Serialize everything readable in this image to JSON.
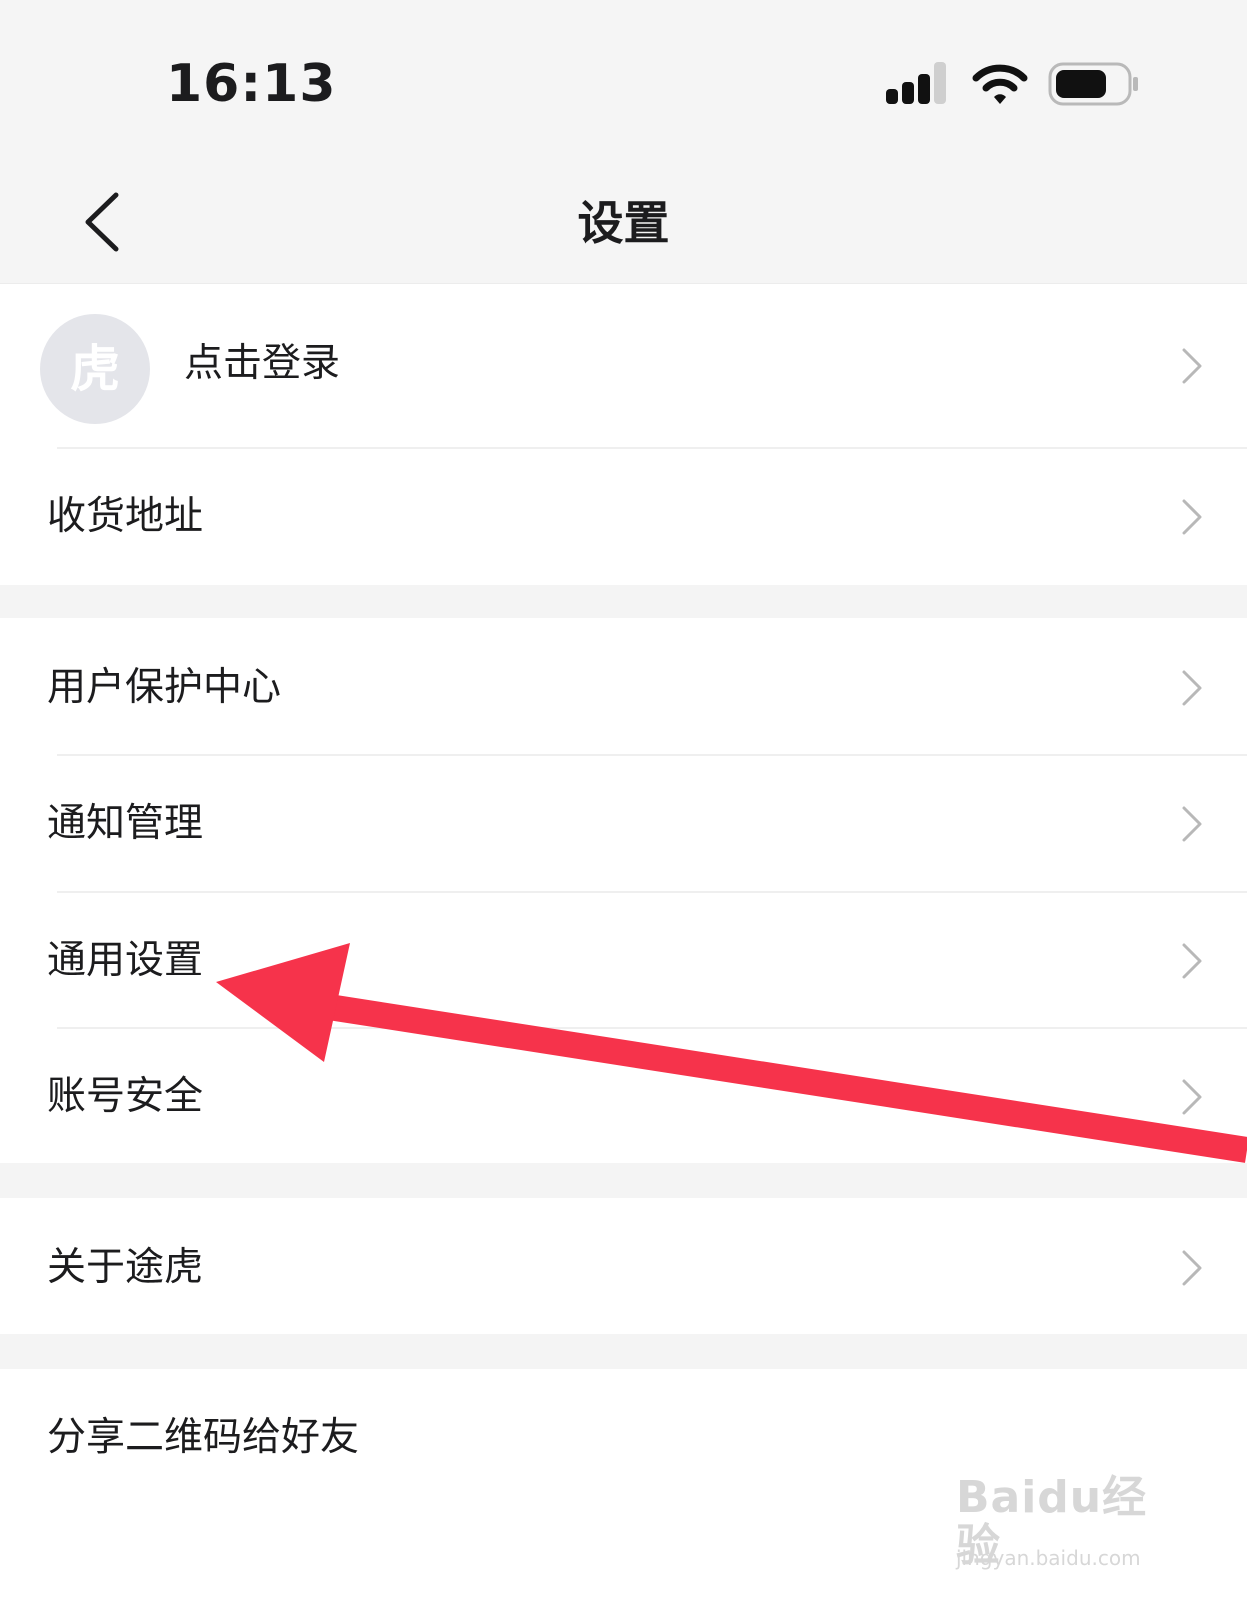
{
  "status_bar": {
    "time": "16:13",
    "signal_icon": "cellular-signal-icon",
    "wifi_icon": "wifi-icon",
    "battery_icon": "battery-icon"
  },
  "nav": {
    "title": "设置",
    "back_icon": "chevron-left-icon"
  },
  "login": {
    "avatar_char": "虎",
    "label": "点击登录"
  },
  "items": [
    {
      "label": "收货地址"
    },
    {
      "label": "用户保护中心"
    },
    {
      "label": "通知管理"
    },
    {
      "label": "通用设置"
    },
    {
      "label": "账号安全"
    },
    {
      "label": "关于途虎"
    },
    {
      "label": "分享二维码给好友"
    }
  ],
  "annotation": {
    "arrow_color": "#f6334b"
  },
  "watermark": {
    "brand": "Baidu经验",
    "url": "jingyan.baidu.com"
  }
}
